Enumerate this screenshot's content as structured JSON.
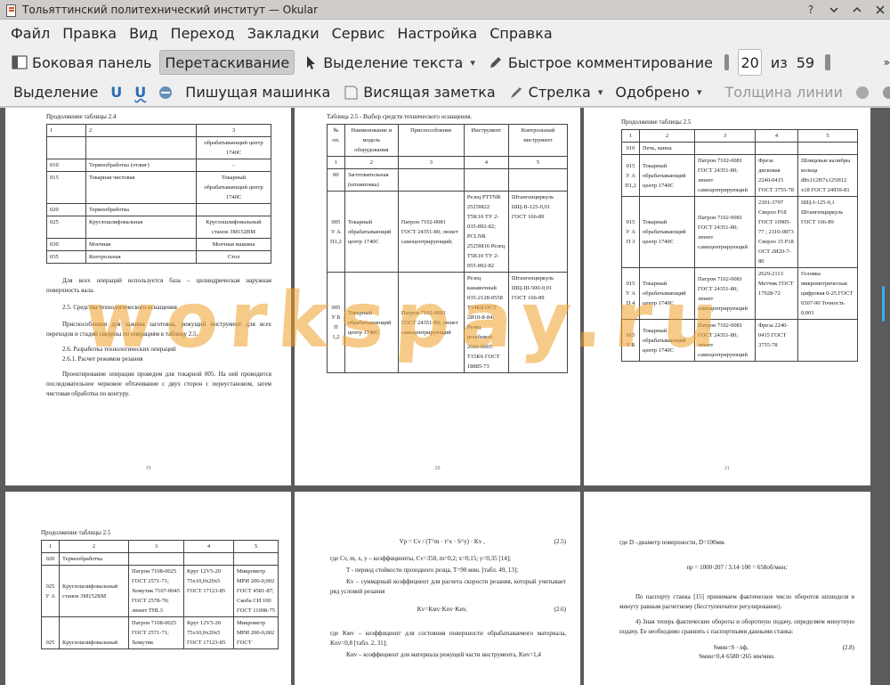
{
  "window": {
    "title": "Тольяттинский политехнический институт  — Okular"
  },
  "menu": [
    "Файл",
    "Правка",
    "Вид",
    "Переход",
    "Закладки",
    "Сервис",
    "Настройка",
    "Справка"
  ],
  "toolbar1": {
    "sidebar": "Боковая панель",
    "drag": "Перетаскивание",
    "text_select": "Выделение текста",
    "quick_comment": "Быстрое комментирование",
    "page_current": "20",
    "page_of": "из",
    "page_total": "59"
  },
  "toolbar2": {
    "highlight": "Выделение",
    "typewriter": "Пишущая машинка",
    "note": "Висящая заметка",
    "arrow": "Стрелка",
    "approved": "Одобрено",
    "line_width": "Толщина линии"
  },
  "colors": {
    "accent": "#3daee9",
    "watermark": "#eea028"
  },
  "watermark": "workspay.ru",
  "page19": {
    "caption": "Продолжение таблицы 2.4",
    "rows": [
      [
        "1",
        "2",
        "3"
      ],
      [
        "",
        "",
        "обрабатывающий центр 1740С"
      ],
      [
        "010",
        "Термообработка (отжиг)",
        "-"
      ],
      [
        "015",
        "Токарная чистовая",
        "Токарный обрабатывающий центр 1740С"
      ],
      [
        "020",
        "Термообработка",
        ""
      ],
      [
        "025",
        "Круглошлифовальная",
        "Круглошлифовальный станок 3М152ВМ"
      ],
      [
        "030",
        "Моечная",
        "Моечная машина"
      ],
      [
        "035",
        "Контрольная",
        "Стол"
      ]
    ],
    "p1": "Для всех операций используется база – цилиндрическая наружная поверхность вала.",
    "h1": "2.5. Средства технологического оснащения",
    "p2": "Приспособления для зажима заготовок, режущий инструмент для всех переходов и стадий сведены по операциям в таблицу 2.5.",
    "h2": "2.6. Разработка технологических операций",
    "h3": "2.6.1. Расчет режимов резания",
    "p3": "Проектирование операции проведем для токарной 005. На ней проводится последовательное черновое обтачивание с двух сторон с переустановом, затем чистовая обработка по контуру.",
    "num": "19"
  },
  "page20": {
    "caption": "Таблица 2.5 - Выбор средств технического оснащения.",
    "header": [
      "№ оп.",
      "Наименование и модель оборудования",
      "Приспособление",
      "Инструмент",
      "Контрольный инструмент"
    ],
    "numrow": [
      "1",
      "2",
      "3",
      "4",
      "5"
    ],
    "rows": [
      [
        "00",
        "Заготовительная (штамповка)",
        "",
        "",
        ""
      ],
      [
        "005 У А П1,2",
        "Токарный обрабатывающий центр 1740С",
        "Патрон 7102-0081 ГОСТ 24351-80; люнет самоцентрирующий;",
        "Резец PTTNR 2525M22 T5K10 ТУ 2-035-892-82; PCLNR 2525M16 Резец T5K10 ТУ 2-055-892-82",
        "Штангенциркуль ШЦ-II-125-0,01 ГОСТ 166-89"
      ],
      [
        "005 У Б П 1,2",
        "Токарный обрабатывающий центр 1740С",
        "Патрон 7102-0081 ГОСТ 24351-80; люнет самоцентрирующий",
        "Резец канавочный 035-2128-0558 T14K8 ОСТ 2И10-8-84; Резец резьбовой 2660-0005 T15K6 ГОСТ 18885-73",
        "Штангенциркуль ШЦ-III-500-0,01 ГОСТ 166-89"
      ]
    ],
    "num": "20"
  },
  "page21": {
    "caption": "Продолжение таблицы 2.5",
    "numrow": [
      "1",
      "2",
      "3",
      "4",
      "5"
    ],
    "rows": [
      [
        "010",
        "Печь, ванна",
        "",
        "",
        ""
      ],
      [
        "015 У А П1,2",
        "Токарный обрабатывающий центр 1740С",
        "Патрон 7102-0081 ГОСТ 24351-80; люнет самоцентрирующий",
        "Фреза дисковая 2240-0415 ГОСТ 3755-78",
        "Шлицевые калибры кольца d8x112H7x125H12 x18 ГОСТ 24959-81"
      ],
      [
        "015 У А П 3",
        "Токарный обрабатывающий центр 1740С",
        "Патрон 7102-0081 ГОСТ 24351-80; люнет самоцентрирующий",
        "2301-3797 Сверло P18 ГОСТ 10905-77 ; 2310-0873 Сверло 15 P18 ОСТ 2И20-7-80",
        "ШЦ-I-125-0,1 Штангенциркуль ГОСТ 166-89"
      ],
      [
        "015 У А П 4",
        "Токарный обрабатывающий центр 1740С",
        "Патрон 7102-0081 ГОСТ 24351-80; люнет самоцентрирующий",
        "2629-2113 Метчик ГОСТ 17928-72",
        "Головка микрометрическая цифровая 0-25 ГОСТ 6507-90 Точность 0,001"
      ],
      [
        "015 У Б",
        "Токарный обрабатывающий центр 1740С",
        "Патрон 7102-0081 ГОСТ 24351-80; люнет самоцентрирующий",
        "Фреза 2240-0415 ГОСТ 3755-78",
        ""
      ]
    ],
    "num": "21"
  },
  "page22": {
    "caption": "Продолжение таблицы 2.5",
    "numrow": [
      "1",
      "2",
      "3",
      "4",
      "5"
    ],
    "rows": [
      [
        "020",
        "Термообработка",
        "",
        "",
        ""
      ],
      [
        "025 У А",
        "Круглошлифовальный станок 3М152ВМ",
        "Патрон 7108-0025 ГОСТ 2571-71; Хомутик 7107-0045 ГОСТ 2578-70; люнет ТНL3",
        "Круг 12V5-20 75x10,0x20x5 ГОСТ 17123-85",
        "Микрометр МРИ 200-0,002 ГОСТ 4581-87; Скоба СИ 100 ГОСТ 11098-75"
      ],
      [
        "025",
        "Круглошлифовальный",
        "Патрон 7108-0025 ГОСТ 2571-71; Хомутик",
        "Круг 12V5-20 75x10,0x20x5 ГОСТ 17123-85",
        "Микрометр МРИ 200-0,002 ГОСТ"
      ]
    ]
  },
  "page23": {
    "f1": "Vр = Cv / (T^m · t^x · S^y) · Kv ,",
    "f1num": "(2.5)",
    "p1": "где Cv, m, x, y – коэффициенты, Cv=350, m=0,2; x=0,15; y=0,35 [14];",
    "p2": "T - период стойкости проходного резца, T=90 мин. [табл. 49, 13];",
    "p3": "Kv – суммарный коэффициент для расчета скорости резания, который учитывает ряд условий резания",
    "f2": "Kv=Kмv·Kпv·Kиv,",
    "f2num": "(2.6)",
    "p4": "где Kмv – коэффициент для состояния поверхности обрабатываемого материала, Kпv=0,8 [табл. 2, 31];",
    "p5": "Kиv – коэффициент для материала режущей части инструмента, Kиv=1,4"
  },
  "page24": {
    "p1": "где D –диаметр поверхности, D=100мм.",
    "f1": "nр = 1000·207 / 3.14·100 = 658об/мин;",
    "p2": "По паспорту станка [15] принимаем фактическое число оборотов шпинделя в минуту равным расчетному (бесступенчатое регулирование).",
    "p3": "4) Зная теперь фактические обороты и оборотную подачу, определяем минутную подачу. Ее необходимо сравнить с паспортными данными станка:",
    "f2": "Sмин=S · nф,",
    "f2num": "(2.8)",
    "f3": "Sмин=0,4·6580=265 мм/мин."
  }
}
